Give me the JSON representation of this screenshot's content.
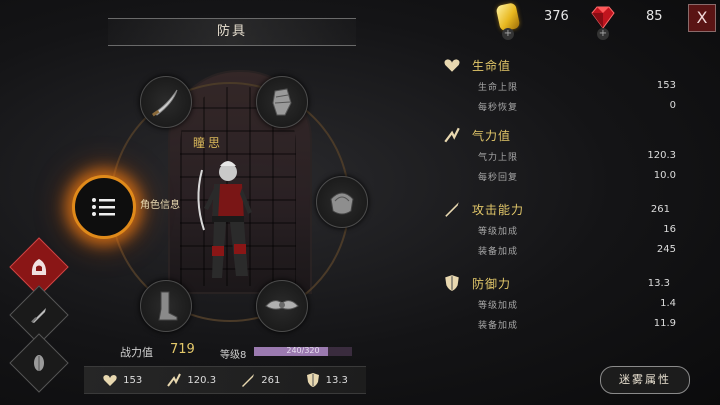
{
  "header": {
    "title": "防具",
    "gold": "376",
    "gems": "85",
    "close_label": "X"
  },
  "character": {
    "name": "瞳思",
    "info_label": "角色信息"
  },
  "power": {
    "label": "战力值",
    "value": "719",
    "level_label": "等级8",
    "xp_text": "240/320",
    "xp_fraction": 0.75
  },
  "bottom_stats": [
    {
      "icon": "heart-icon",
      "value": "153"
    },
    {
      "icon": "stamina-icon",
      "value": "120.3"
    },
    {
      "icon": "sword-icon",
      "value": "261"
    },
    {
      "icon": "shield-icon",
      "value": "13.3"
    }
  ],
  "attributes": {
    "life": {
      "title": "生命值",
      "rows": [
        {
          "label": "生命上限",
          "value": "153"
        },
        {
          "label": "每秒恢复",
          "value": "0"
        }
      ]
    },
    "stamina": {
      "title": "气力值",
      "rows": [
        {
          "label": "气力上限",
          "value": "120.3"
        },
        {
          "label": "每秒回复",
          "value": "10.0"
        }
      ]
    },
    "attack": {
      "title": "攻击能力",
      "value": "261",
      "rows": [
        {
          "label": "等级加成",
          "value": "16"
        },
        {
          "label": "装备加成",
          "value": "245"
        }
      ]
    },
    "defense": {
      "title": "防御力",
      "value": "13.3",
      "rows": [
        {
          "label": "等级加成",
          "value": "1.4"
        },
        {
          "label": "装备加成",
          "value": "11.9"
        }
      ]
    }
  },
  "fog_button": "迷雾属性",
  "colors": {
    "accent_gold": "#e3c86a",
    "active_glow": "#e08a1a",
    "active_tab": "#8a1616"
  }
}
